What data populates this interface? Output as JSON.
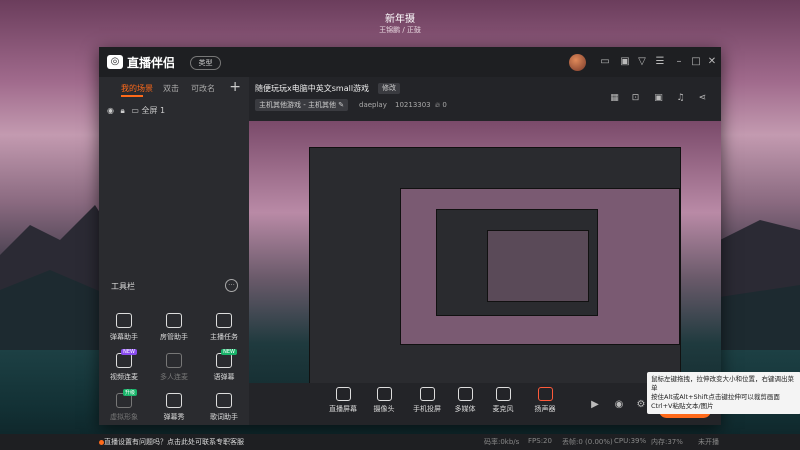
{
  "desktop": {
    "title": "新年摄",
    "subtitle": "王锦鹏 / 正鼓"
  },
  "app": {
    "brand": "直播伴侣",
    "type_button": "类型",
    "tabs": [
      "我的场景",
      "双击",
      "可改名"
    ],
    "scene": {
      "label": "全屏 1"
    },
    "tools_header": "工具栏",
    "tools": [
      {
        "label": "弹幕助手"
      },
      {
        "label": "房管助手"
      },
      {
        "label": "主播任务"
      },
      {
        "label": "视频连麦",
        "badge": "NEW"
      },
      {
        "label": "多人连麦",
        "dim": true
      },
      {
        "label": "语弹幕",
        "badge": "NEW"
      },
      {
        "label": "虚拟形象",
        "badge": "升级",
        "dim": true
      },
      {
        "label": "弹幕秀"
      },
      {
        "label": "歌词助手"
      }
    ],
    "room": {
      "title": "随便玩玩x电脑中英文small游戏",
      "edit": "修改",
      "category": "主机其他游戏 - 主机其他",
      "user": "daeplay",
      "id": "10213303",
      "heat": "0"
    },
    "bottom": [
      {
        "label": "直播屏幕"
      },
      {
        "label": "摄像头"
      },
      {
        "label": "手机投屏"
      },
      {
        "label": "多媒体"
      },
      {
        "label": "麦克风"
      },
      {
        "label": "扬声器",
        "red": true
      }
    ],
    "go_live": "开始直播 (1/6)",
    "status": {
      "warn": "直播设置有问题吗？点击此处可联系专职客服",
      "bitrate": "码率:0kb/s",
      "fps": "FPS:20",
      "drop": "丢帧:0 (0.00%)",
      "cpu": "CPU:39%",
      "mem": "内存:37%",
      "state": "未开播"
    }
  },
  "tooltip": {
    "line1": "鼠标左键拖拽，拉伸改变大小和位置，右键调出菜单",
    "line2": "按住Alt或Alt+Shift点击键拉伸可以裁剪画面",
    "line3": "Ctrl+V粘贴文本/图片"
  },
  "colors": {
    "accent": "#ff6a1a",
    "bg": "#1e1f22",
    "panel": "#2a2b2f"
  }
}
